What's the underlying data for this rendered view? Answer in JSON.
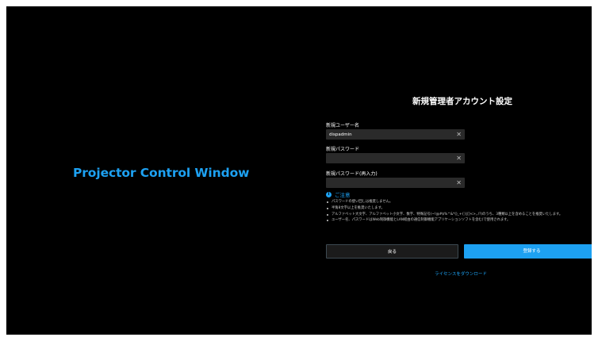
{
  "brand": {
    "title": "Projector Control Window"
  },
  "form": {
    "title": "新規管理者アカウント設定",
    "username": {
      "label": "新規ユーザー名",
      "value": "dispadmin"
    },
    "password": {
      "label": "新規パスワード",
      "value": ""
    },
    "password_confirm": {
      "label": "新規パスワード(再入力)",
      "value": ""
    },
    "clear_glyph": "✕",
    "notice": {
      "icon": "info-icon",
      "icon_glyph": "i",
      "heading": "ご注意",
      "items": [
        "パスワードの使い回しは推奨しません。",
        "半角8文字以上を推奨いたします。",
        "アルファベット大文字、アルファベット小文字、数字、特殊記号(~!@#$%^&*()_+{}|[]<>,./?)のうち、3種類以上を含めることを推奨いたします。",
        "ユーザー名、パスワードはWeb制御機能とLAN経由の通信制御機能アプリケーションソフトを含む)で使用されます。"
      ]
    },
    "buttons": {
      "back": "戻る",
      "register": "登録する"
    },
    "license_link": "ライセンスをダウンロード"
  },
  "colors": {
    "accent": "#1da1f2",
    "background": "#000000",
    "field": "#2a2a2a"
  }
}
